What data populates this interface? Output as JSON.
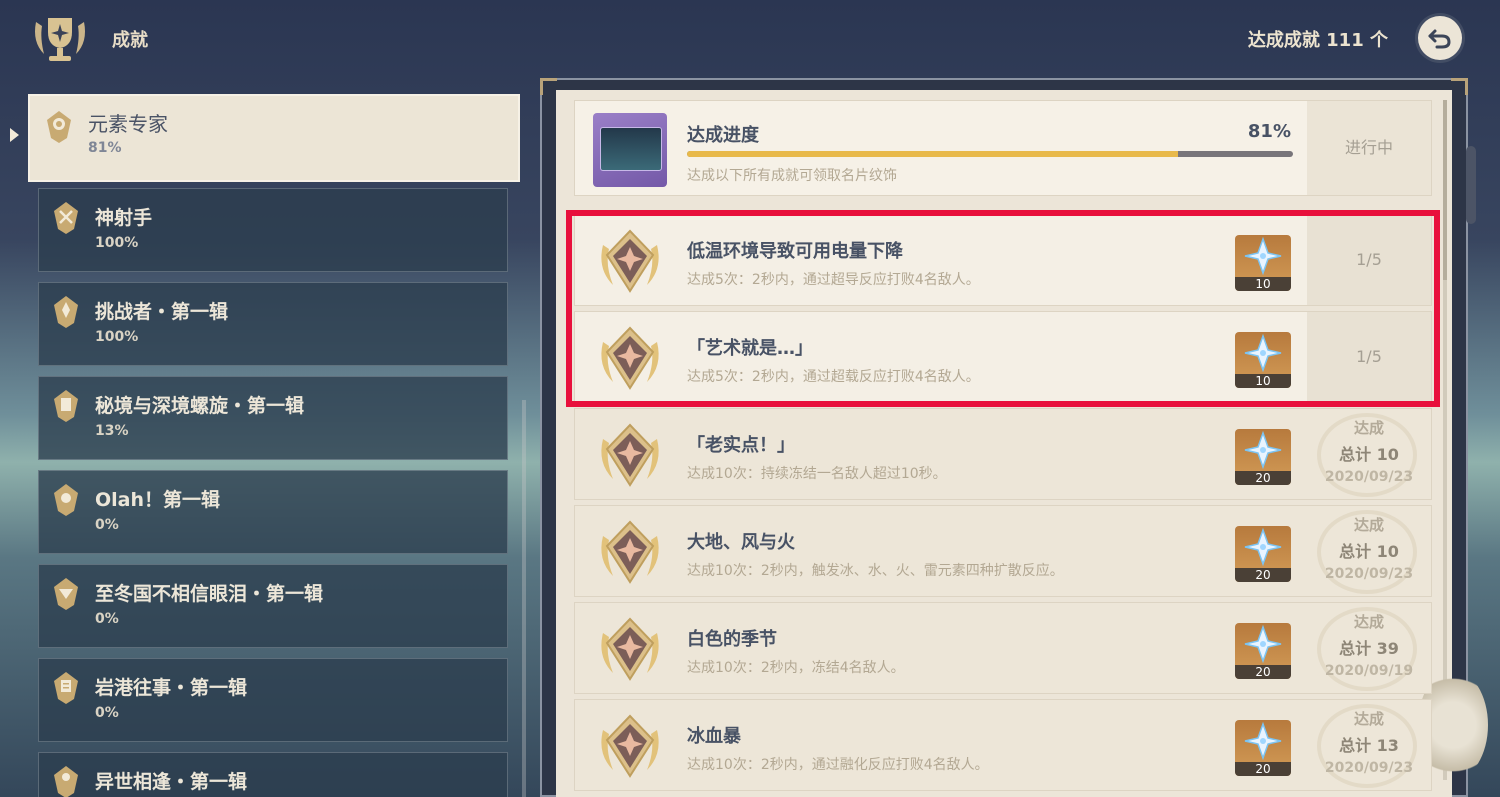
{
  "header": {
    "title": "成就",
    "count_text": "达成成就 111 个"
  },
  "sidebar": {
    "items": [
      {
        "name": "元素专家",
        "percent": "81%",
        "active": true
      },
      {
        "name": "神射手",
        "percent": "100%"
      },
      {
        "name": "挑战者・第一辑",
        "percent": "100%"
      },
      {
        "name": "秘境与深境螺旋・第一辑",
        "percent": "13%"
      },
      {
        "name": "Olah！第一辑",
        "percent": "0%"
      },
      {
        "name": "至冬国不相信眼泪・第一辑",
        "percent": "0%"
      },
      {
        "name": "岩港往事・第一辑",
        "percent": "0%"
      },
      {
        "name": "异世相逢・第一辑",
        "percent": ""
      }
    ]
  },
  "progress": {
    "title": "达成进度",
    "percent_text": "81%",
    "fraction": 0.81,
    "desc": "达成以下所有成就可领取名片纹饰",
    "status": "进行中"
  },
  "achievements": [
    {
      "title": "低温环境导致可用电量下降",
      "desc": "达成5次：2秒内，通过超导反应打败4名敌人。",
      "reward": "10",
      "status": "1/5"
    },
    {
      "title": "「艺术就是…」",
      "desc": "达成5次：2秒内，通过超载反应打败4名敌人。",
      "reward": "10",
      "status": "1/5"
    },
    {
      "title": "「老实点！」",
      "desc": "达成10次：持续冻结一名敌人超过10秒。",
      "reward": "20",
      "done_label": "达成",
      "total": "总计 10",
      "date": "2020/09/23"
    },
    {
      "title": "大地、风与火",
      "desc": "达成10次：2秒内，触发冰、水、火、雷元素四种扩散反应。",
      "reward": "20",
      "done_label": "达成",
      "total": "总计 10",
      "date": "2020/09/23"
    },
    {
      "title": "白色的季节",
      "desc": "达成10次：2秒内，冻结4名敌人。",
      "reward": "20",
      "done_label": "达成",
      "total": "总计 39",
      "date": "2020/09/19"
    },
    {
      "title": "冰血暴",
      "desc": "达成10次：2秒内，通过融化反应打败4名敌人。",
      "reward": "20",
      "done_label": "达成",
      "total": "总计 13",
      "date": "2020/09/23"
    }
  ],
  "colors": {
    "accent": "#e8b94a",
    "highlight": "#e8103c",
    "panel": "#ece5d8",
    "sidebar_item": "#2c3e4e"
  },
  "icons": {
    "header": "trophy-icon",
    "back": "back-arrow-icon",
    "badge": "achievement-badge-icon",
    "reward": "primogem-icon"
  }
}
